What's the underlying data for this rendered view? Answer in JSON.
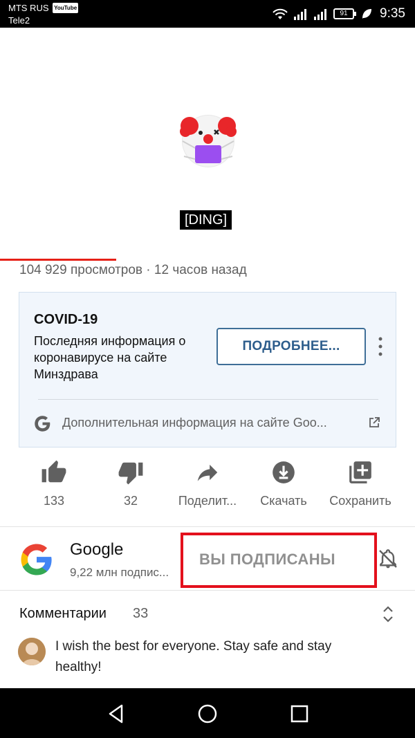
{
  "status_bar": {
    "carrier_primary": "MTS RUS",
    "carrier_badge": "YouTube",
    "carrier_secondary": "Tele2",
    "battery": "91",
    "time": "9:35"
  },
  "video": {
    "caption": "[DING]",
    "progress_fraction": 0.28
  },
  "meta": {
    "views_line": "104 929 просмотров · 12 часов назад"
  },
  "covid_card": {
    "title": "COVID-19",
    "body": "Последняя информация о коронавирусе на сайте Минздрава",
    "button_label": "ПОДРОБНЕЕ...",
    "link_text": "Дополнительная информация на сайте Goo..."
  },
  "actions": {
    "like_count": "133",
    "dislike_count": "32",
    "share_label": "Поделит...",
    "download_label": "Скачать",
    "save_label": "Сохранить"
  },
  "channel": {
    "name": "Google",
    "subscribers": "9,22 млн подпис...",
    "subscribed_label": "ВЫ ПОДПИСАНЫ"
  },
  "comments": {
    "title": "Комментарии",
    "count": "33",
    "top_comment": "I wish the best for everyone. Stay safe and stay healthy!"
  },
  "colors": {
    "accent_red": "#e62117",
    "highlight_box": "#e3101c",
    "covid_button": "#2d5d8c"
  }
}
